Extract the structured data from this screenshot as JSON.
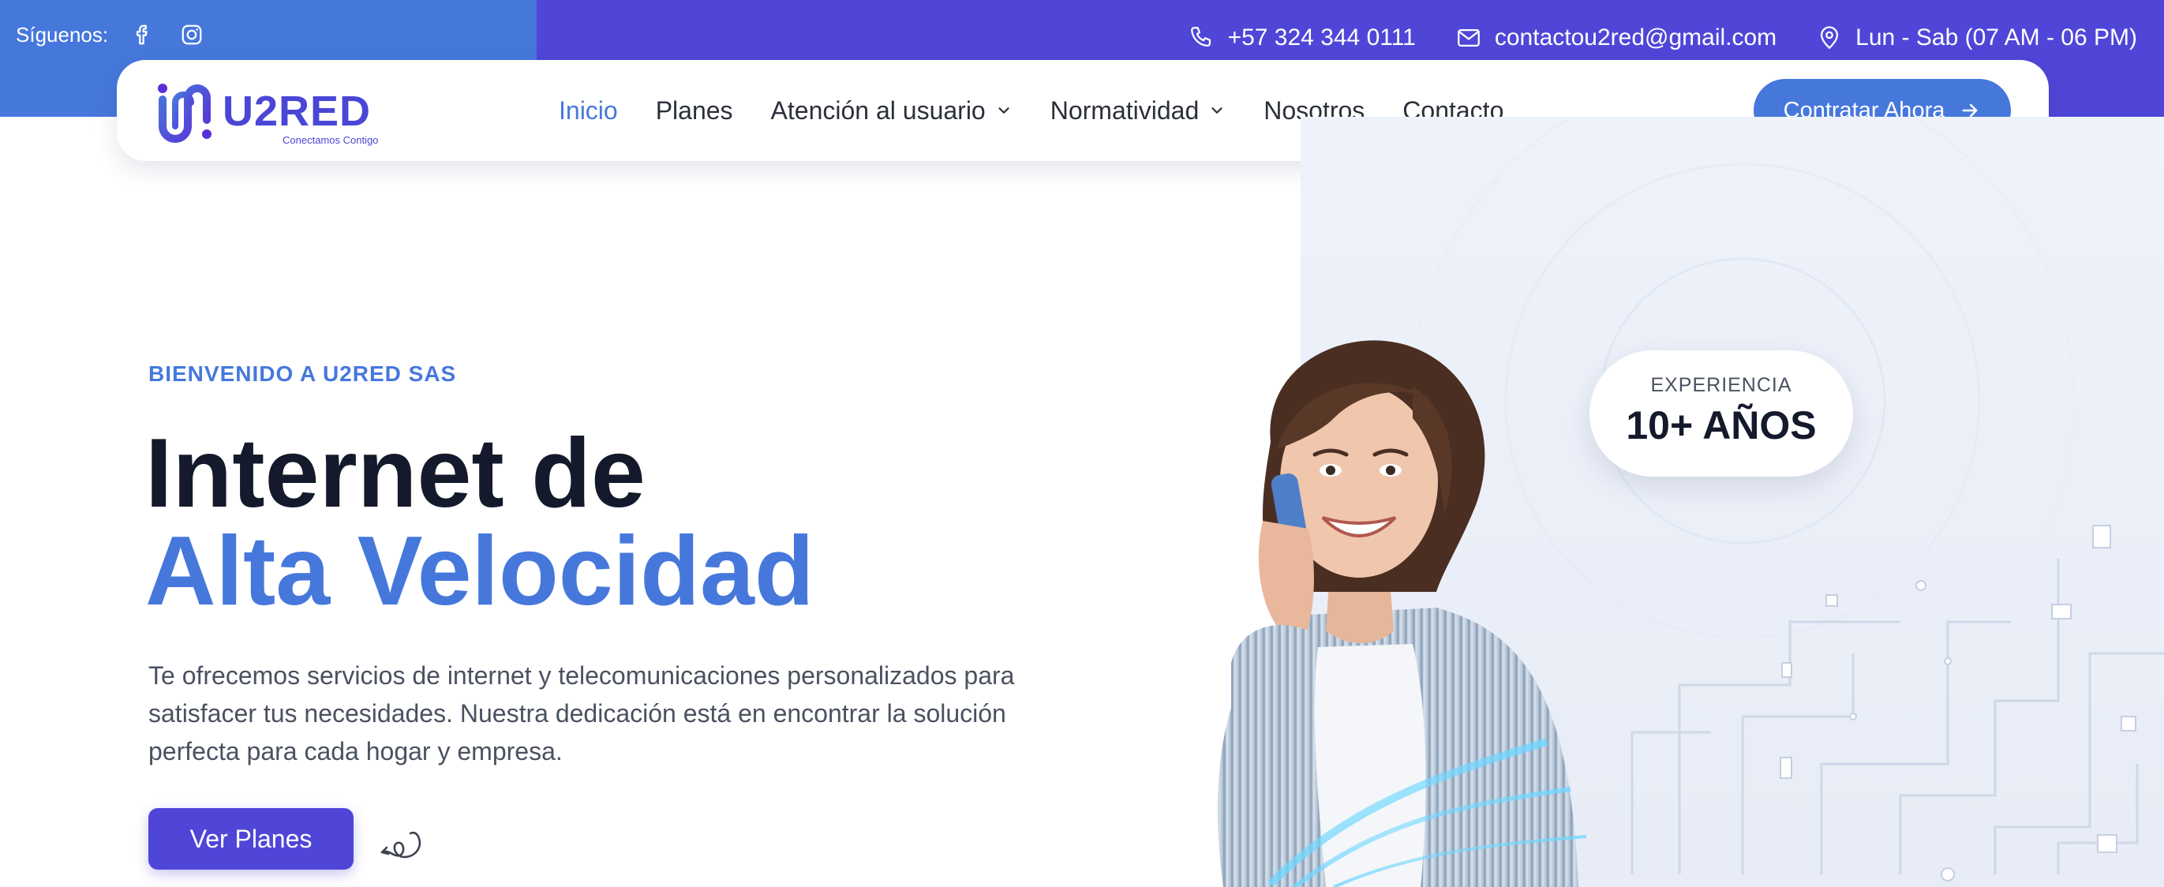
{
  "topbar": {
    "follow_label": "Síguenos:",
    "social": [
      "facebook-icon",
      "instagram-icon"
    ],
    "phone": "+57 324 344 0111",
    "email": "contactou2red@gmail.com",
    "hours": "Lun - Sab (07 AM - 06 PM)"
  },
  "brand": {
    "name": "U2RED",
    "tagline": "Conectamos Contigo"
  },
  "nav": {
    "items": [
      {
        "label": "Inicio",
        "active": true,
        "dropdown": false
      },
      {
        "label": "Planes",
        "active": false,
        "dropdown": false
      },
      {
        "label": "Atención al usuario",
        "active": false,
        "dropdown": true
      },
      {
        "label": "Normatividad",
        "active": false,
        "dropdown": true
      },
      {
        "label": "Nosotros",
        "active": false,
        "dropdown": false
      },
      {
        "label": "Contacto",
        "active": false,
        "dropdown": false
      }
    ],
    "cta_label": "Contratar Ahora"
  },
  "hero": {
    "eyebrow": "BIENVENIDO A U2RED SAS",
    "title_line1": "Internet de",
    "title_line2": "Alta Velocidad",
    "description": "Te ofrecemos servicios de internet y telecomunicaciones personalizados para satisfacer tus necesidades. Nuestra dedicación está en encontrar la solución perfecta para cada hogar y empresa.",
    "button_label": "Ver Planes",
    "badge_label": "EXPERIENCIA",
    "badge_value": "10+ AÑOS"
  },
  "colors": {
    "primary_blue": "#4678dc",
    "violet": "#4f46d8",
    "heading_dark": "#141a2b"
  }
}
